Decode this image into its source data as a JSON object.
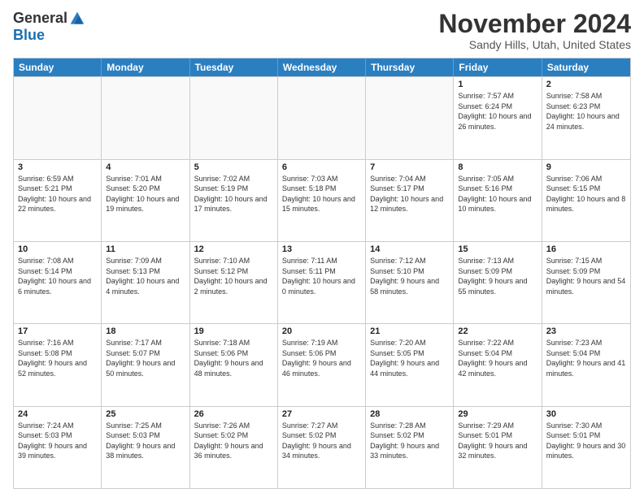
{
  "logo": {
    "general": "General",
    "blue": "Blue"
  },
  "header": {
    "month": "November 2024",
    "location": "Sandy Hills, Utah, United States"
  },
  "weekdays": [
    "Sunday",
    "Monday",
    "Tuesday",
    "Wednesday",
    "Thursday",
    "Friday",
    "Saturday"
  ],
  "rows": [
    [
      {
        "day": "",
        "empty": true
      },
      {
        "day": "",
        "empty": true
      },
      {
        "day": "",
        "empty": true
      },
      {
        "day": "",
        "empty": true
      },
      {
        "day": "",
        "empty": true
      },
      {
        "day": "1",
        "sunrise": "7:57 AM",
        "sunset": "6:24 PM",
        "daylight": "10 hours and 26 minutes."
      },
      {
        "day": "2",
        "sunrise": "7:58 AM",
        "sunset": "6:23 PM",
        "daylight": "10 hours and 24 minutes."
      }
    ],
    [
      {
        "day": "3",
        "sunrise": "6:59 AM",
        "sunset": "5:21 PM",
        "daylight": "10 hours and 22 minutes."
      },
      {
        "day": "4",
        "sunrise": "7:01 AM",
        "sunset": "5:20 PM",
        "daylight": "10 hours and 19 minutes."
      },
      {
        "day": "5",
        "sunrise": "7:02 AM",
        "sunset": "5:19 PM",
        "daylight": "10 hours and 17 minutes."
      },
      {
        "day": "6",
        "sunrise": "7:03 AM",
        "sunset": "5:18 PM",
        "daylight": "10 hours and 15 minutes."
      },
      {
        "day": "7",
        "sunrise": "7:04 AM",
        "sunset": "5:17 PM",
        "daylight": "10 hours and 12 minutes."
      },
      {
        "day": "8",
        "sunrise": "7:05 AM",
        "sunset": "5:16 PM",
        "daylight": "10 hours and 10 minutes."
      },
      {
        "day": "9",
        "sunrise": "7:06 AM",
        "sunset": "5:15 PM",
        "daylight": "10 hours and 8 minutes."
      }
    ],
    [
      {
        "day": "10",
        "sunrise": "7:08 AM",
        "sunset": "5:14 PM",
        "daylight": "10 hours and 6 minutes."
      },
      {
        "day": "11",
        "sunrise": "7:09 AM",
        "sunset": "5:13 PM",
        "daylight": "10 hours and 4 minutes."
      },
      {
        "day": "12",
        "sunrise": "7:10 AM",
        "sunset": "5:12 PM",
        "daylight": "10 hours and 2 minutes."
      },
      {
        "day": "13",
        "sunrise": "7:11 AM",
        "sunset": "5:11 PM",
        "daylight": "10 hours and 0 minutes."
      },
      {
        "day": "14",
        "sunrise": "7:12 AM",
        "sunset": "5:10 PM",
        "daylight": "9 hours and 58 minutes."
      },
      {
        "day": "15",
        "sunrise": "7:13 AM",
        "sunset": "5:09 PM",
        "daylight": "9 hours and 55 minutes."
      },
      {
        "day": "16",
        "sunrise": "7:15 AM",
        "sunset": "5:09 PM",
        "daylight": "9 hours and 54 minutes."
      }
    ],
    [
      {
        "day": "17",
        "sunrise": "7:16 AM",
        "sunset": "5:08 PM",
        "daylight": "9 hours and 52 minutes."
      },
      {
        "day": "18",
        "sunrise": "7:17 AM",
        "sunset": "5:07 PM",
        "daylight": "9 hours and 50 minutes."
      },
      {
        "day": "19",
        "sunrise": "7:18 AM",
        "sunset": "5:06 PM",
        "daylight": "9 hours and 48 minutes."
      },
      {
        "day": "20",
        "sunrise": "7:19 AM",
        "sunset": "5:06 PM",
        "daylight": "9 hours and 46 minutes."
      },
      {
        "day": "21",
        "sunrise": "7:20 AM",
        "sunset": "5:05 PM",
        "daylight": "9 hours and 44 minutes."
      },
      {
        "day": "22",
        "sunrise": "7:22 AM",
        "sunset": "5:04 PM",
        "daylight": "9 hours and 42 minutes."
      },
      {
        "day": "23",
        "sunrise": "7:23 AM",
        "sunset": "5:04 PM",
        "daylight": "9 hours and 41 minutes."
      }
    ],
    [
      {
        "day": "24",
        "sunrise": "7:24 AM",
        "sunset": "5:03 PM",
        "daylight": "9 hours and 39 minutes."
      },
      {
        "day": "25",
        "sunrise": "7:25 AM",
        "sunset": "5:03 PM",
        "daylight": "9 hours and 38 minutes."
      },
      {
        "day": "26",
        "sunrise": "7:26 AM",
        "sunset": "5:02 PM",
        "daylight": "9 hours and 36 minutes."
      },
      {
        "day": "27",
        "sunrise": "7:27 AM",
        "sunset": "5:02 PM",
        "daylight": "9 hours and 34 minutes."
      },
      {
        "day": "28",
        "sunrise": "7:28 AM",
        "sunset": "5:02 PM",
        "daylight": "9 hours and 33 minutes."
      },
      {
        "day": "29",
        "sunrise": "7:29 AM",
        "sunset": "5:01 PM",
        "daylight": "9 hours and 32 minutes."
      },
      {
        "day": "30",
        "sunrise": "7:30 AM",
        "sunset": "5:01 PM",
        "daylight": "9 hours and 30 minutes."
      }
    ]
  ]
}
